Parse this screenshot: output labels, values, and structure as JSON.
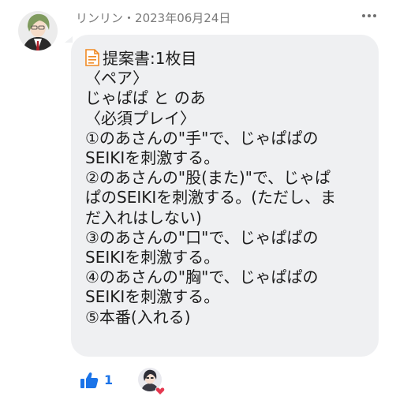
{
  "post": {
    "author": "リンリン",
    "separator": "・",
    "date": "2023年06月24日",
    "more_icon": "more-horizontal-icon",
    "doc_icon": "document-icon",
    "title": "提案書:1枚目",
    "lines": [
      "〈ペア〉",
      "じゃぱぱ と のあ",
      "〈必須プレイ〉",
      "①のあさんの\"手\"で、じゃぱぱの",
      "SEIKIを刺激する。",
      "②のあさんの\"股(また)\"で、じゃぱ",
      "ぱのSEIKIを刺激する。(ただし、ま",
      "だ入れはしない)",
      "③のあさんの\"口\"で、じゃぱぱの",
      "SEIKIを刺激する。",
      "④のあさんの\"胸\"で、じゃぱぱの",
      "SEIKIを刺激する。",
      "⑤本番(入れる)"
    ]
  },
  "reactions": {
    "like_icon": "thumbs-up-icon",
    "like_count": "1",
    "heart_icon": "heart-icon",
    "colors": {
      "like": "#1a73e8",
      "heart": "#e53950",
      "doc": "#f08a24"
    }
  }
}
